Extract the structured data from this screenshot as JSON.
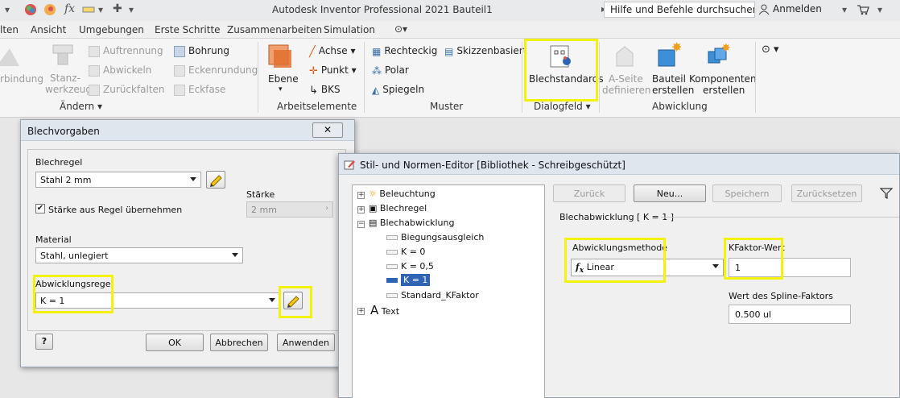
{
  "titlebar": {
    "app_title": "Autodesk Inventor Professional 2021   Bauteil1",
    "search_placeholder": "Hilfe und Befehle durchsuchen...",
    "signin_label": "Anmelden"
  },
  "tabs": [
    "lten",
    "Ansicht",
    "Umgebungen",
    "Erste Schritte",
    "Zusammenarbeiten",
    "Simulation"
  ],
  "ribbon": {
    "aendern": {
      "verbindung": "rbindung",
      "stanz_line1": "Stanz-",
      "stanz_line2": "werkzeug",
      "auftrennung": "Auftrennung",
      "abwickeln": "Abwickeln",
      "zurueckfalten": "Zurückfalten",
      "bohrung": "Bohrung",
      "eckenrundung": "Eckenrundung",
      "eckfase": "Eckfase",
      "group_label": "Ändern"
    },
    "arbeitselemente": {
      "ebene": "Ebene",
      "achse": "Achse",
      "punkt": "Punkt",
      "bks": "BKS",
      "group_label": "Arbeitselemente"
    },
    "muster": {
      "rechteckig": "Rechteckig",
      "skizzenbasiert": "Skizzenbasiert",
      "polar": "Polar",
      "spiegeln": "Spiegeln",
      "group_label": "Muster"
    },
    "dialogfeld": {
      "blechstandards": "Blechstandards",
      "group_label": "Dialogfeld"
    },
    "abwicklung": {
      "aseite_line1": "A-Seite",
      "aseite_line2": "definieren",
      "bauteil_line1": "Bauteil",
      "bauteil_line2": "erstellen",
      "komponenten_line1": "Komponenten",
      "komponenten_line2": "erstellen",
      "group_label": "Abwicklung"
    }
  },
  "blechvorgaben": {
    "title": "Blechvorgaben",
    "blechregel_label": "Blechregel",
    "blechregel_value": "Stahl 2 mm",
    "staerke_checkbox_label": "Stärke aus Regel übernehmen",
    "staerke_label": "Stärke",
    "staerke_value": "2 mm",
    "material_label": "Material",
    "material_value": "Stahl, unlegiert",
    "abwicklungsregel_label": "Abwicklungsregel",
    "abwicklungsregel_value": "K = 1",
    "help_label": "?",
    "ok_label": "OK",
    "abbrechen_label": "Abbrechen",
    "anwenden_label": "Anwenden"
  },
  "style_editor": {
    "title": "Stil- und Normen-Editor [Bibliothek - Schreibgeschützt]",
    "tree": {
      "beleuchtung": "Beleuchtung",
      "blechregel": "Blechregel",
      "blechabwicklung": "Blechabwicklung",
      "biegungsausgleich": "Biegungsausgleich",
      "k0": "K = 0",
      "k05": "K = 0,5",
      "k1": "K = 1",
      "standard_kfaktor": "Standard_KFaktor",
      "text": "Text"
    },
    "toolbar": {
      "zurueck": "Zurück",
      "neu": "Neu...",
      "speichern": "Speichern",
      "zuruecksetzen": "Zurücksetzen"
    },
    "section_title": "Blechabwicklung [ K = 1 ]",
    "abwicklungsmethode_label": "Abwicklungsmethode",
    "abwicklungsmethode_value": "Linear",
    "kfaktor_label": "KFaktor-Wert",
    "kfaktor_value": "1",
    "spline_label": "Wert des Spline-Faktors",
    "spline_value": "0.500 ul"
  },
  "colors": {
    "highlight": "#f2f20c",
    "selection": "#2f64b4"
  }
}
